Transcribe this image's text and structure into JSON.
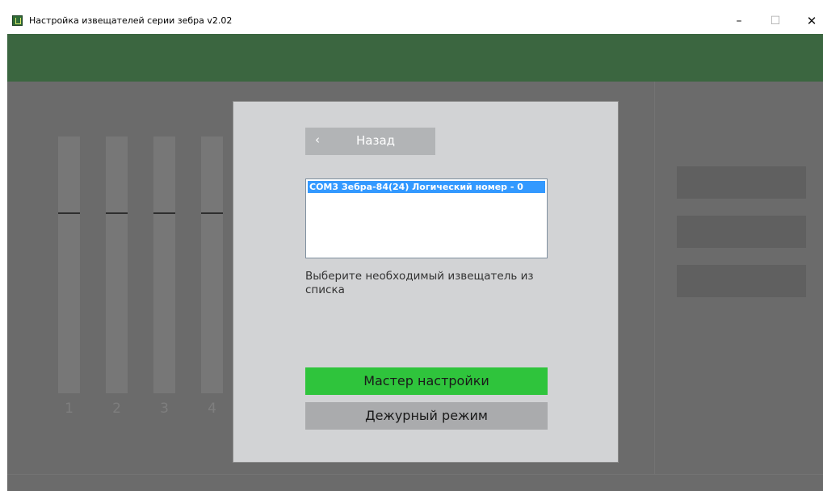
{
  "window": {
    "title": "Настройка извещателей серии зебра v2.02",
    "minimize": "–",
    "maximize": "☐",
    "close": "✕"
  },
  "sliders": [
    {
      "label": "1"
    },
    {
      "label": "2"
    },
    {
      "label": "3"
    },
    {
      "label": "4"
    }
  ],
  "dialog": {
    "back_chevron": "‹",
    "back_label": "Назад",
    "list_items": [
      "COM3 Зебра-84(24) Логический номер - 0"
    ],
    "instruction": "Выберите необходимый извещатель из списка",
    "master_label": "Мастер настройки",
    "duty_label": "Дежурный режим"
  },
  "colors": {
    "header_green": "#3b6640",
    "background_gray": "#6b6b6b",
    "dialog_bg": "#d2d3d5",
    "master_green": "#2fc43c",
    "selection_blue": "#3399ff"
  }
}
